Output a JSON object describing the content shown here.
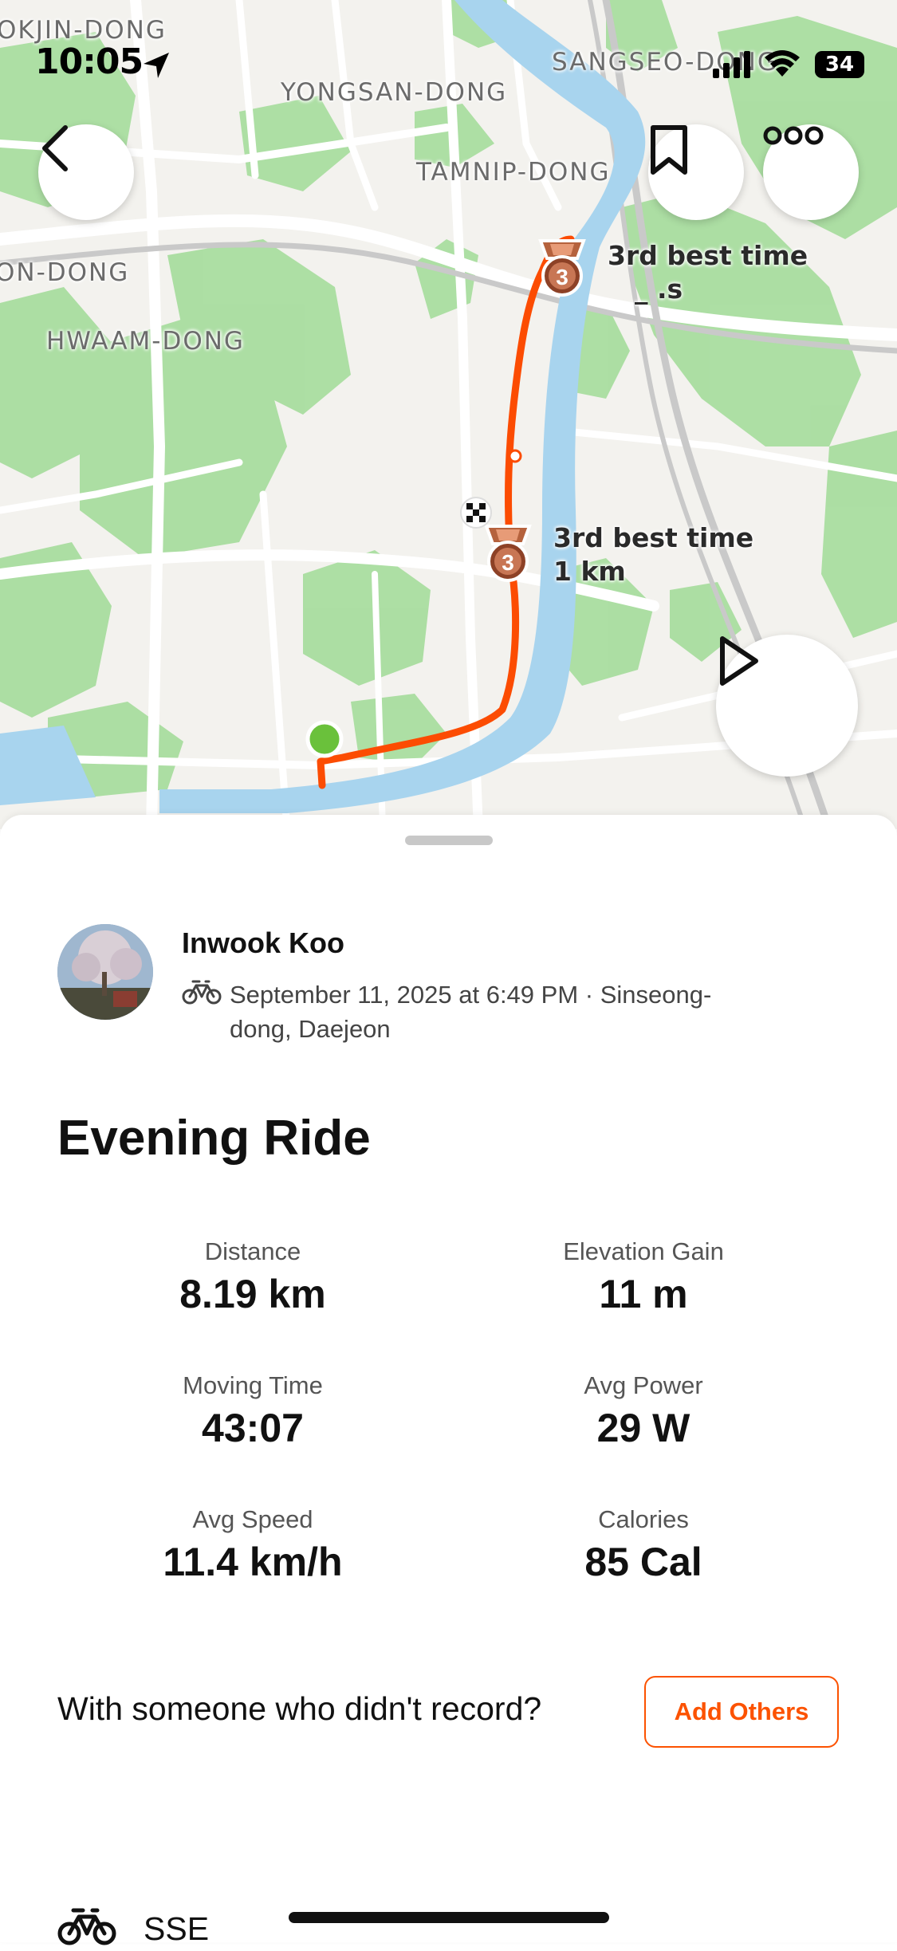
{
  "status_bar": {
    "time": "10:05",
    "battery": "34",
    "icons": [
      "location-arrow-icon",
      "signal-icon",
      "wifi-icon",
      "battery-icon"
    ]
  },
  "map": {
    "labels": {
      "okjin": "OKJIN-DONG",
      "sangseo": "SANGSEO-DONG",
      "yongsan": "YONGSAN-DONG",
      "tamnip": "TAMNIP-DONG",
      "on_dong": "ON-DONG",
      "hwaam": "HWAAM-DONG"
    },
    "achievements": [
      {
        "line1": "3rd best time",
        "line2": "_   .s",
        "rank": "3"
      },
      {
        "line1": "3rd best time",
        "line2": "1 km",
        "rank": "3"
      }
    ],
    "colors": {
      "route": "#fc4c02",
      "water": "#a8d4ee",
      "park": "#a9dd9f",
      "start": "#6ac13b",
      "medal": "#b5623d"
    },
    "buttons": [
      "back-icon",
      "bookmark-icon",
      "more-icon",
      "play-icon"
    ]
  },
  "athlete": {
    "name": "Inwook Koo",
    "meta": "September 11, 2025 at 6:49 PM · Sinseong-dong, Daejeon",
    "sport_icon": "bike-icon"
  },
  "activity": {
    "title": "Evening Ride",
    "stats": [
      {
        "label": "Distance",
        "value": "8.19 km"
      },
      {
        "label": "Elevation Gain",
        "value": "11 m"
      },
      {
        "label": "Moving Time",
        "value": "43:07"
      },
      {
        "label": "Avg Power",
        "value": "29 W"
      },
      {
        "label": "Avg Speed",
        "value": "11.4 km/h"
      },
      {
        "label": "Calories",
        "value": "85 Cal"
      }
    ]
  },
  "with_others": {
    "prompt": "With someone who didn't record?",
    "button": "Add Others"
  },
  "gear": {
    "name": "SSE",
    "icon": "bike-icon"
  },
  "accent_color": "#fc5200"
}
